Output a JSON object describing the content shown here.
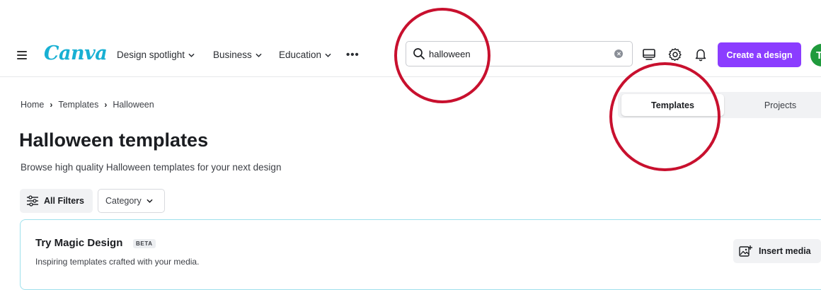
{
  "header": {
    "logo": "Canva",
    "nav": [
      {
        "label": "Design spotlight"
      },
      {
        "label": "Business"
      },
      {
        "label": "Education"
      }
    ],
    "more_label": "•••",
    "search": {
      "value": "halloween"
    },
    "create_button": "Create a design",
    "avatar_initial": "T",
    "icons": [
      "menu-icon",
      "search-icon",
      "clear-icon",
      "desktop-icon",
      "gear-icon",
      "bell-icon",
      "chevron-down-icon"
    ]
  },
  "breadcrumb": [
    "Home",
    "Templates",
    "Halloween"
  ],
  "tabs": [
    {
      "label": "Templates",
      "active": true
    },
    {
      "label": "Projects",
      "active": false
    }
  ],
  "page": {
    "title": "Halloween templates",
    "subtitle": "Browse high quality Halloween templates for your next design"
  },
  "filters": {
    "all_filters": "All Filters",
    "category": "Category"
  },
  "magic_card": {
    "title": "Try Magic Design",
    "badge": "BETA",
    "text": "Inspiring templates crafted with your media.",
    "button": "Insert media"
  },
  "colors": {
    "brand_cyan": "#18b0d3",
    "primary_purple": "#8b3dff",
    "annotation_red": "#c8102e",
    "avatar_green": "#1f9a3c"
  }
}
